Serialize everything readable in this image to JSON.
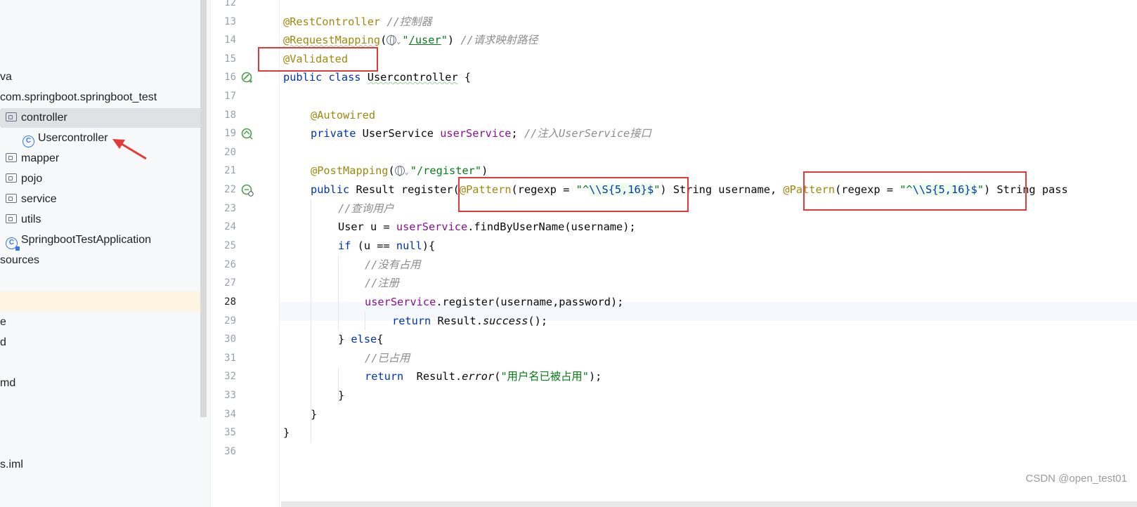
{
  "sidebar": {
    "rows": [
      {
        "label": "va",
        "type": "text"
      },
      {
        "label": "com.springboot.springboot_test",
        "type": "package"
      },
      {
        "label": "controller",
        "type": "folder"
      },
      {
        "label": "Usercontroller",
        "type": "class"
      },
      {
        "label": "mapper",
        "type": "folder"
      },
      {
        "label": "pojo",
        "type": "folder"
      },
      {
        "label": "service",
        "type": "folder"
      },
      {
        "label": "utils",
        "type": "folder"
      },
      {
        "label": "SpringbootTestApplication",
        "type": "app-class"
      },
      {
        "label": "sources",
        "type": "text"
      },
      {
        "label": "e",
        "type": "text"
      },
      {
        "label": "d",
        "type": "text"
      },
      {
        "label": "md",
        "type": "text"
      },
      {
        "label": "s.iml",
        "type": "text"
      }
    ]
  },
  "editor": {
    "current_line": 28,
    "line_numbers": [
      "12",
      "13",
      "14",
      "15",
      "16",
      "17",
      "18",
      "19",
      "20",
      "21",
      "22",
      "23",
      "24",
      "25",
      "26",
      "27",
      "28",
      "29",
      "30",
      "31",
      "32",
      "33",
      "34",
      "35",
      "36"
    ],
    "code": {
      "l13_ann": "@RestController",
      "l13_cmt": "//控制器",
      "l14_ann": "@RequestMapping",
      "l14_open": "(",
      "l14_str_q1": "\"",
      "l14_str_path": "/user",
      "l14_str_q2": "\"",
      "l14_close": ")",
      "l14_cmt": "//请求映射路径",
      "l15_ann": "@Validated",
      "l16_kw": "public class",
      "l16_name": "Usercontroller",
      "l16_rest": " {",
      "l18_ann": "@Autowired",
      "l19_kw": "private",
      "l19_type": " UserService ",
      "l19_field": "userService",
      "l19_semi": "; ",
      "l19_cmt": "//注入UserService接口",
      "l21_ann": "@PostMapping",
      "l21_open": "(",
      "l21_str": "\"/register\"",
      "l21_close": ")",
      "l22_kw": "public",
      "l22_type": " Result ",
      "l22_name": "register",
      "l22_open": "(",
      "l22_ann1": "@Pattern",
      "l22_p1": "(regexp = ",
      "l22_s1a": "\"^",
      "l22_s1b": "\\\\S{5,16}$",
      "l22_s1c": "\"",
      "l22_p1end": ") String username, ",
      "l22_ann2": "@Pattern",
      "l22_p2": "(regexp = ",
      "l22_s2a": "\"^",
      "l22_s2b": "\\\\S{5,16}$",
      "l22_s2c": "\"",
      "l22_p2end": ") String pass",
      "l23_cmt": "//查询用户",
      "l24_a": "User u = ",
      "l24_field": "userService",
      "l24_b": ".findByUserName(username);",
      "l25_kw1": "if",
      "l25_a": " (u == ",
      "l25_kw2": "null",
      "l25_b": "){",
      "l26_cmt": "//没有占用",
      "l27_cmt": "//注册",
      "l28_field": "userService",
      "l28_b": ".register(username,password);",
      "l29_kw": "return",
      "l29_a": " Result.",
      "l29_it": "success",
      "l29_b": "();",
      "l30_a": "} ",
      "l30_kw": "else",
      "l30_b": "{",
      "l31_cmt": "//已占用",
      "l32_kw": "return",
      "l32_a": "  Result.",
      "l32_it": "error",
      "l32_b": "(",
      "l32_str": "\"用户名已被占用\"",
      "l32_c": ");",
      "l33": "}",
      "l34": "}",
      "l35": "}"
    }
  },
  "watermark": "CSDN @open_test01",
  "colors": {
    "annotation": "#9e880d",
    "keyword": "#0033b3",
    "comment": "#8c8c8c",
    "string": "#067d17",
    "field": "#871094",
    "highlight_box": "#e03a3a"
  }
}
